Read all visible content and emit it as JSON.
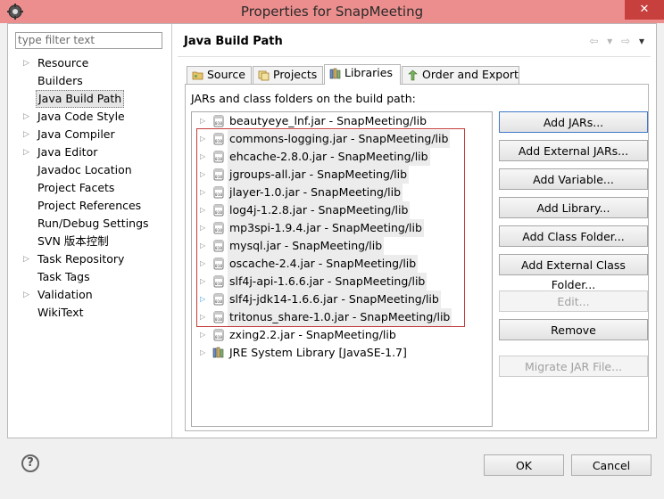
{
  "window": {
    "title": "Properties for SnapMeeting",
    "close_glyph": "✕"
  },
  "filter": {
    "placeholder": "type filter text"
  },
  "nav_items": [
    {
      "label": "Resource",
      "has_arrow": true
    },
    {
      "label": "Builders",
      "has_arrow": false
    },
    {
      "label": "Java Build Path",
      "has_arrow": false,
      "selected": true
    },
    {
      "label": "Java Code Style",
      "has_arrow": true
    },
    {
      "label": "Java Compiler",
      "has_arrow": true
    },
    {
      "label": "Java Editor",
      "has_arrow": true
    },
    {
      "label": "Javadoc Location",
      "has_arrow": false
    },
    {
      "label": "Project Facets",
      "has_arrow": false
    },
    {
      "label": "Project References",
      "has_arrow": false
    },
    {
      "label": "Run/Debug Settings",
      "has_arrow": false
    },
    {
      "label": "SVN 版本控制",
      "has_arrow": false
    },
    {
      "label": "Task Repository",
      "has_arrow": true
    },
    {
      "label": "Task Tags",
      "has_arrow": false
    },
    {
      "label": "Validation",
      "has_arrow": true
    },
    {
      "label": "WikiText",
      "has_arrow": false
    }
  ],
  "page": {
    "title": "Java Build Path",
    "back_glyph": "⇦",
    "forward_glyph": "⇨",
    "menu_glyph": "▾"
  },
  "tabs": [
    {
      "label": "Source"
    },
    {
      "label": "Projects"
    },
    {
      "label": "Libraries",
      "active": true
    },
    {
      "label": "Order and Export"
    }
  ],
  "libraries": {
    "list_label": "JARs and class folders on the build path:",
    "items": [
      {
        "text": "beautyeye_lnf.jar - SnapMeeting/lib",
        "boxed": false
      },
      {
        "text": "commons-logging.jar - SnapMeeting/lib",
        "boxed": true
      },
      {
        "text": "ehcache-2.8.0.jar - SnapMeeting/lib",
        "boxed": true
      },
      {
        "text": "jgroups-all.jar - SnapMeeting/lib",
        "boxed": true
      },
      {
        "text": "jlayer-1.0.jar - SnapMeeting/lib",
        "boxed": true
      },
      {
        "text": "log4j-1.2.8.jar - SnapMeeting/lib",
        "boxed": true
      },
      {
        "text": "mp3spi-1.9.4.jar - SnapMeeting/lib",
        "boxed": true
      },
      {
        "text": "mysql.jar - SnapMeeting/lib",
        "boxed": true
      },
      {
        "text": "oscache-2.4.jar - SnapMeeting/lib",
        "boxed": true
      },
      {
        "text": "slf4j-api-1.6.6.jar - SnapMeeting/lib",
        "boxed": true
      },
      {
        "text": "slf4j-jdk14-1.6.6.jar - SnapMeeting/lib",
        "boxed": true,
        "blue_arrow": true
      },
      {
        "text": "tritonus_share-1.0.jar - SnapMeeting/lib",
        "boxed": true
      },
      {
        "text": "zxing2.2.jar - SnapMeeting/lib",
        "boxed": false
      },
      {
        "text": "JRE System Library [JavaSE-1.7]",
        "boxed": false,
        "jre": true
      }
    ]
  },
  "side_buttons": {
    "add_jars": "Add JARs...",
    "add_external_jars": "Add External JARs...",
    "add_variable": "Add Variable...",
    "add_library": "Add Library...",
    "add_class_folder": "Add Class Folder...",
    "add_external_class_folder": "Add External Class Folder...",
    "edit": "Edit...",
    "remove": "Remove",
    "migrate_jar": "Migrate JAR File..."
  },
  "dialog": {
    "help_glyph": "?",
    "ok": "OK",
    "cancel": "Cancel"
  },
  "colors": {
    "titlebar": "#eb8e8d",
    "close_button": "#c7403e",
    "highlight_box": "#c43b3b"
  }
}
